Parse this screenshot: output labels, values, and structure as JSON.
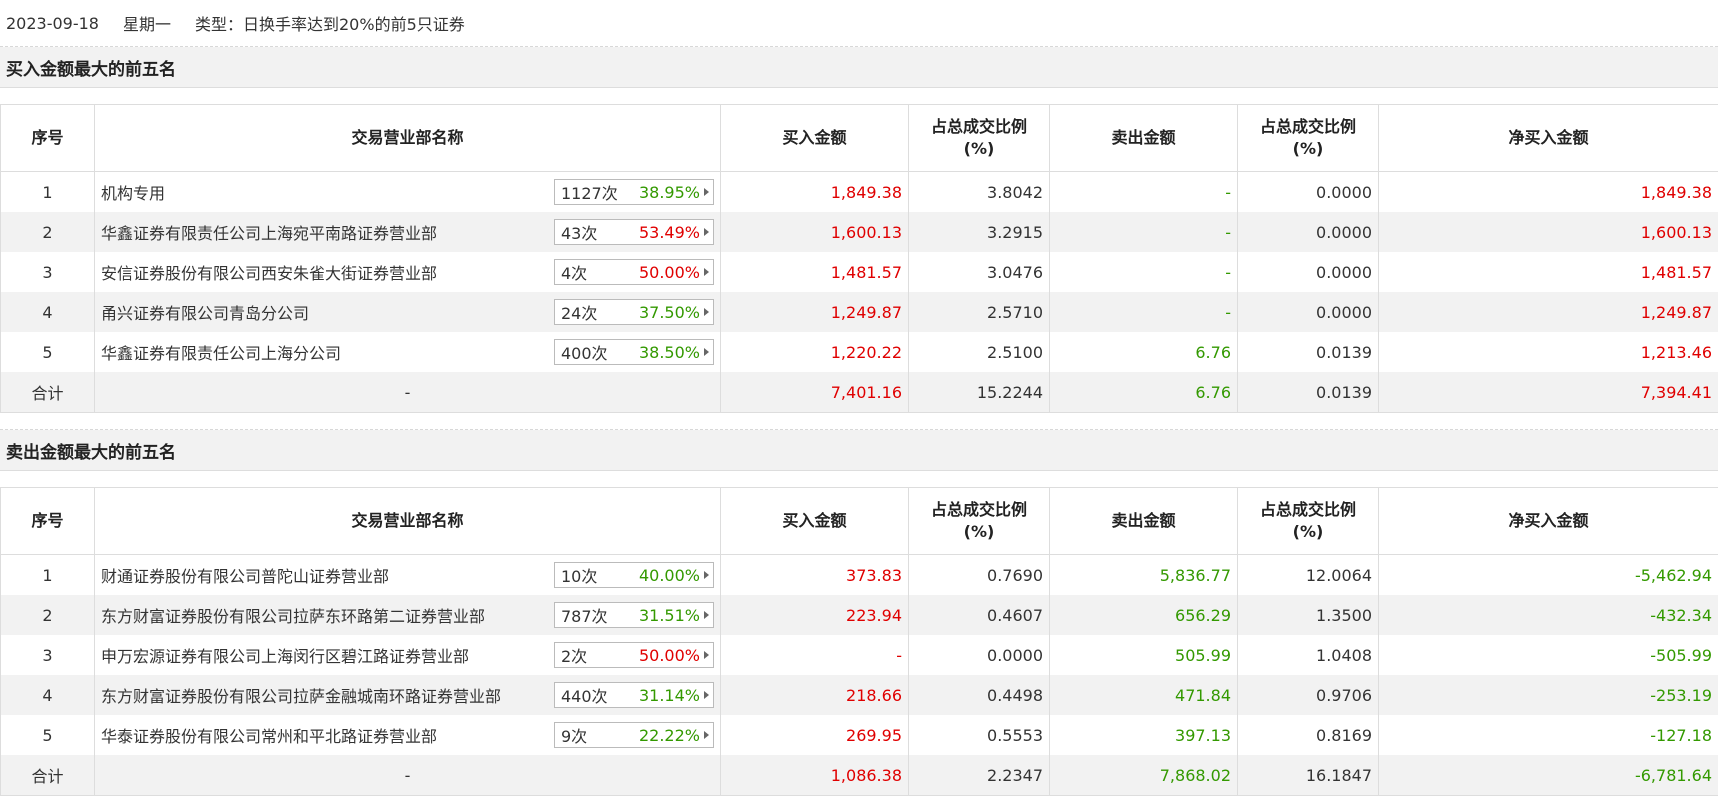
{
  "header": {
    "date": "2023-09-18",
    "weekday": "星期一",
    "type_label": "类型：日换手率达到20%的前5只证券"
  },
  "columns": {
    "seq": "序号",
    "name": "交易营业部名称",
    "buy": "买入金额",
    "ratio1_l1": "占总成交比例",
    "ratio1_l2": "(%)",
    "sell": "卖出金额",
    "ratio2_l1": "占总成交比例",
    "ratio2_l2": "(%)",
    "net": "净买入金额"
  },
  "colors": {
    "positive": "#e00000",
    "negative": "#339900"
  },
  "buy_section": {
    "title": "买入金额最大的前五名",
    "rows": [
      {
        "seq": "1",
        "name": "机构专用",
        "count": "1127次",
        "pct": "38.95%",
        "pct_color": "green",
        "buy": "1,849.38",
        "buy_ratio": "3.8042",
        "sell": "-",
        "sell_ratio": "0.0000",
        "net": "1,849.38"
      },
      {
        "seq": "2",
        "name": "华鑫证券有限责任公司上海宛平南路证券营业部",
        "count": "43次",
        "pct": "53.49%",
        "pct_color": "red",
        "buy": "1,600.13",
        "buy_ratio": "3.2915",
        "sell": "-",
        "sell_ratio": "0.0000",
        "net": "1,600.13"
      },
      {
        "seq": "3",
        "name": "安信证券股份有限公司西安朱雀大街证券营业部",
        "count": "4次",
        "pct": "50.00%",
        "pct_color": "red",
        "buy": "1,481.57",
        "buy_ratio": "3.0476",
        "sell": "-",
        "sell_ratio": "0.0000",
        "net": "1,481.57"
      },
      {
        "seq": "4",
        "name": "甬兴证券有限公司青岛分公司",
        "count": "24次",
        "pct": "37.50%",
        "pct_color": "green",
        "buy": "1,249.87",
        "buy_ratio": "2.5710",
        "sell": "-",
        "sell_ratio": "0.0000",
        "net": "1,249.87"
      },
      {
        "seq": "5",
        "name": "华鑫证券有限责任公司上海分公司",
        "count": "400次",
        "pct": "38.50%",
        "pct_color": "green",
        "buy": "1,220.22",
        "buy_ratio": "2.5100",
        "sell": "6.76",
        "sell_ratio": "0.0139",
        "net": "1,213.46"
      }
    ],
    "total": {
      "label": "合计",
      "name": "-",
      "buy": "7,401.16",
      "buy_ratio": "15.2244",
      "sell": "6.76",
      "sell_ratio": "0.0139",
      "net": "7,394.41"
    }
  },
  "sell_section": {
    "title": "卖出金额最大的前五名",
    "rows": [
      {
        "seq": "1",
        "name": "财通证券股份有限公司普陀山证券营业部",
        "count": "10次",
        "pct": "40.00%",
        "pct_color": "green",
        "buy": "373.83",
        "buy_ratio": "0.7690",
        "sell": "5,836.77",
        "sell_ratio": "12.0064",
        "net": "-5,462.94"
      },
      {
        "seq": "2",
        "name": "东方财富证券股份有限公司拉萨东环路第二证券营业部",
        "count": "787次",
        "pct": "31.51%",
        "pct_color": "green",
        "buy": "223.94",
        "buy_ratio": "0.4607",
        "sell": "656.29",
        "sell_ratio": "1.3500",
        "net": "-432.34"
      },
      {
        "seq": "3",
        "name": "申万宏源证券有限公司上海闵行区碧江路证券营业部",
        "count": "2次",
        "pct": "50.00%",
        "pct_color": "red",
        "buy": "-",
        "buy_ratio": "0.0000",
        "sell": "505.99",
        "sell_ratio": "1.0408",
        "net": "-505.99"
      },
      {
        "seq": "4",
        "name": "东方财富证券股份有限公司拉萨金融城南环路证券营业部",
        "count": "440次",
        "pct": "31.14%",
        "pct_color": "green",
        "buy": "218.66",
        "buy_ratio": "0.4498",
        "sell": "471.84",
        "sell_ratio": "0.9706",
        "net": "-253.19"
      },
      {
        "seq": "5",
        "name": "华泰证券股份有限公司常州和平北路证券营业部",
        "count": "9次",
        "pct": "22.22%",
        "pct_color": "green",
        "buy": "269.95",
        "buy_ratio": "0.5553",
        "sell": "397.13",
        "sell_ratio": "0.8169",
        "net": "-127.18"
      }
    ],
    "total": {
      "label": "合计",
      "name": "-",
      "buy": "1,086.38",
      "buy_ratio": "2.2347",
      "sell": "7,868.02",
      "sell_ratio": "16.1847",
      "net": "-6,781.64"
    }
  }
}
